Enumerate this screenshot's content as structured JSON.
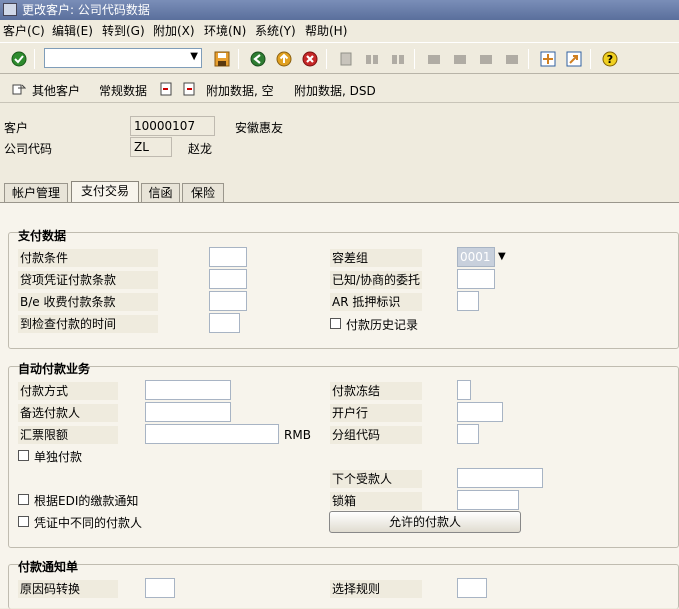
{
  "window": {
    "title": "更改客户: 公司代码数据"
  },
  "menu": [
    "客户(C)",
    "编辑(E)",
    "转到(G)",
    "附加(X)",
    "环境(N)",
    "系统(Y)",
    "帮助(H)"
  ],
  "app_toolbar": {
    "other_customer": "其他客户",
    "general_data": "常规数据",
    "additional_empty": "附加数据, 空",
    "additional_dsd": "附加数据, DSD"
  },
  "header": {
    "customer_label": "客户",
    "customer_value": "10000107",
    "customer_name": "安徽惠友",
    "company_code_label": "公司代码",
    "company_code_value": "ZL",
    "company_name": "赵龙"
  },
  "tabs": [
    "帐户管理",
    "支付交易",
    "信函",
    "保险"
  ],
  "payment_data": {
    "title": "支付数据",
    "terms": "付款条件",
    "bill_terms": "贷项凭证付款条款",
    "be_terms": "B/e 收费付款条款",
    "check_time": "到检查付款的时间",
    "tolerance_group": "容差组",
    "tolerance_value": "0001",
    "known_agent": "已知/协商的委托",
    "ar_pledge": "AR 抵押标识",
    "history": "付款历史记录"
  },
  "auto_payment": {
    "title": "自动付款业务",
    "method": "付款方式",
    "alt_payer": "备选付款人",
    "bill_limit": "汇票限额",
    "currency": "RMB",
    "single_payment": "单独付款",
    "block": "付款冻结",
    "house_bank": "开户行",
    "group_key": "分组代码",
    "next_payee": "下个受款人",
    "edi_advice": "根据EDI的缴款通知",
    "lockbox": "锁箱",
    "diff_payer": "凭证中不同的付款人",
    "allowed_payer_btn": "允许的付款人"
  },
  "remittance": {
    "title": "付款通知单",
    "reason_conv": "原因码转换",
    "selection_rule": "选择规则"
  }
}
